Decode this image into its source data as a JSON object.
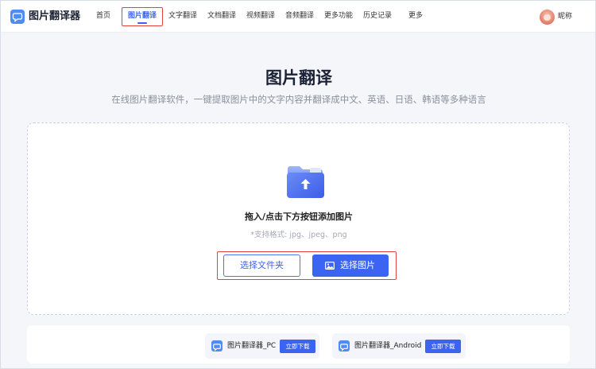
{
  "app": {
    "logo_text": "图片翻译器",
    "brand_color": "#3c64f3",
    "highlight_color": "#e0453c"
  },
  "nav": {
    "items": [
      {
        "label": "首页"
      },
      {
        "label": "图片翻译",
        "active": true
      },
      {
        "label": "文字翻译"
      },
      {
        "label": "文档翻译"
      },
      {
        "label": "视频翻译"
      },
      {
        "label": "音频翻译"
      },
      {
        "label": "更多功能"
      },
      {
        "label": "历史记录"
      },
      {
        "label": "更多"
      }
    ],
    "username": "昵称"
  },
  "hero": {
    "title": "图片翻译",
    "subtitle": "在线图片翻译软件，一键提取图片中的文字内容并翻译成中文、英语、日语、韩语等多种语言"
  },
  "upload": {
    "hint": "拖入/点击下方按钮添加图片",
    "formats": "*支持格式: jpg、jpeg、png",
    "select_folder_label": "选择文件夹",
    "select_image_label": "选择图片",
    "icons": {
      "folder": "folder-upload-icon",
      "image": "image-icon"
    }
  },
  "downloads": [
    {
      "name": "图片翻译器_PC",
      "button": "立即下载"
    },
    {
      "name": "图片翻译器_Android",
      "button": "立即下载"
    }
  ]
}
